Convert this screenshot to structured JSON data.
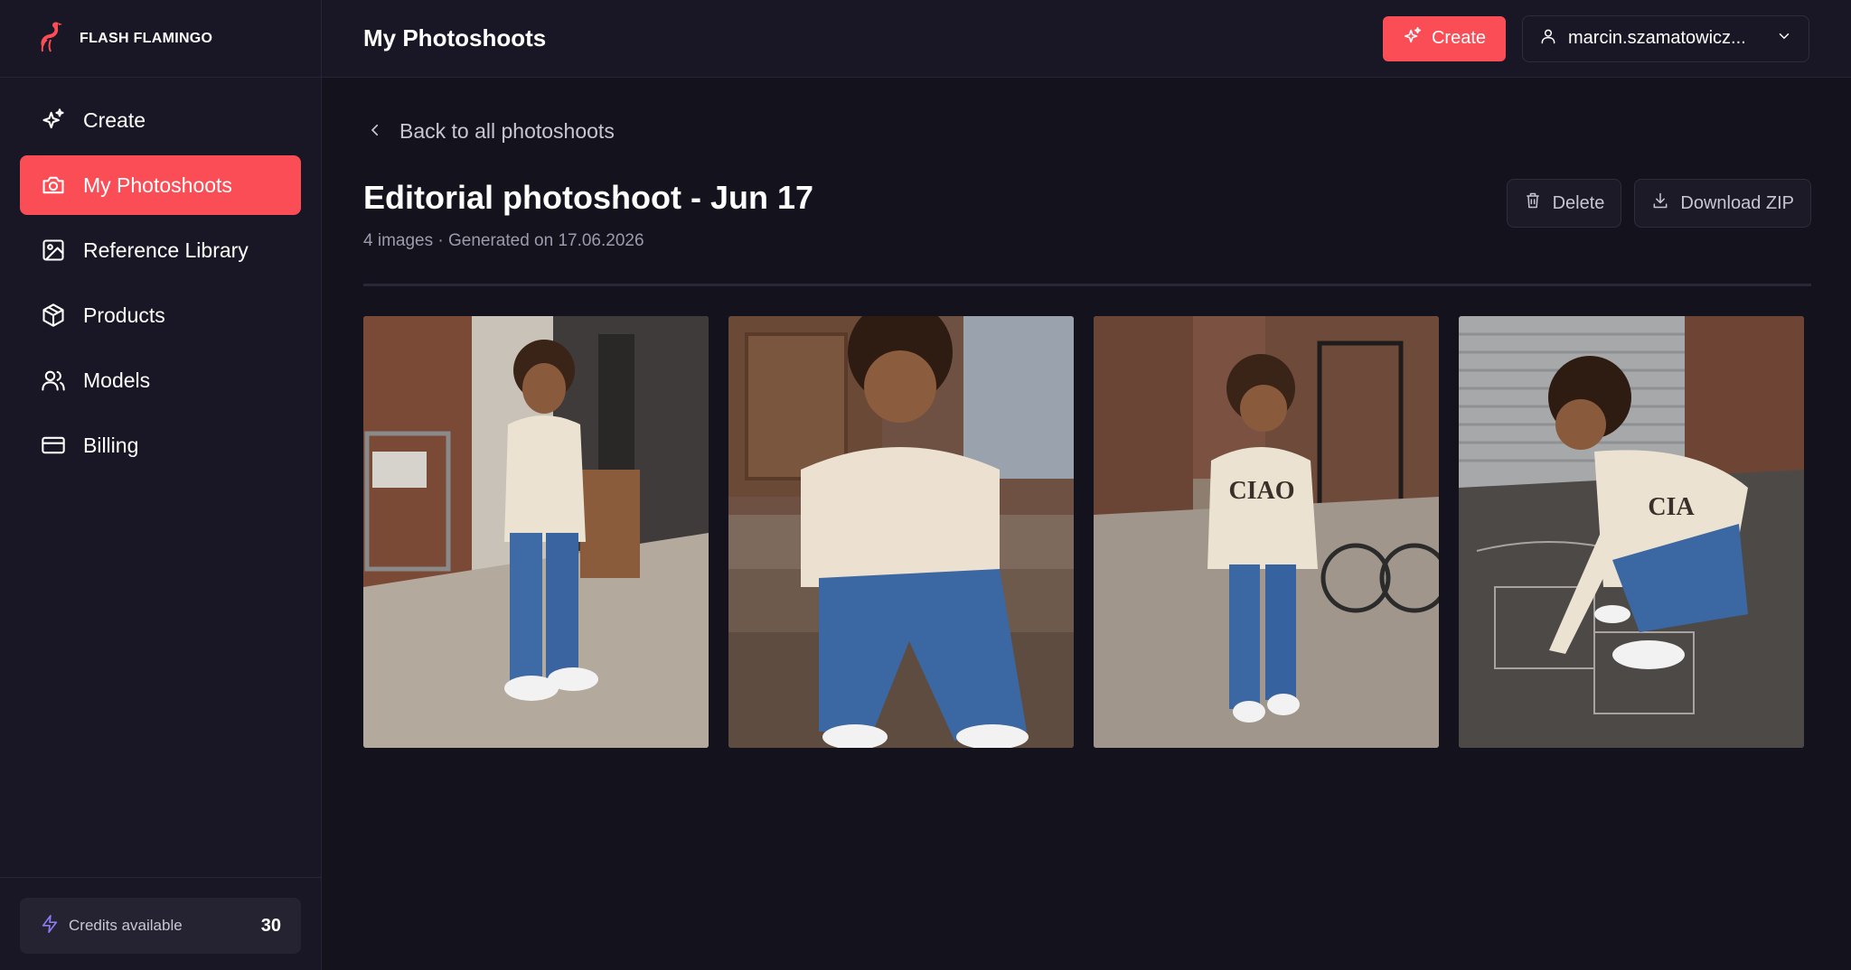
{
  "brand": {
    "name": "FLASH FLAMINGO"
  },
  "header": {
    "title": "My Photoshoots",
    "create_label": "Create",
    "user_name": "marcin.szamatowicz..."
  },
  "sidebar": {
    "items": [
      {
        "label": "Create",
        "icon": "sparkle-icon"
      },
      {
        "label": "My Photoshoots",
        "icon": "camera-icon",
        "active": true
      },
      {
        "label": "Reference Library",
        "icon": "image-icon"
      },
      {
        "label": "Products",
        "icon": "box-icon"
      },
      {
        "label": "Models",
        "icon": "users-icon"
      },
      {
        "label": "Billing",
        "icon": "credit-card-icon"
      }
    ],
    "credits_label": "Credits available",
    "credits_value": "30"
  },
  "main": {
    "back_label": "Back to all photoshoots",
    "title": "Editorial photoshoot - Jun 17",
    "subtitle": "4 images · Generated on 17.06.2026",
    "delete_label": "Delete",
    "download_label": "Download ZIP",
    "photos": [
      {
        "name": "photo-1"
      },
      {
        "name": "photo-2"
      },
      {
        "name": "photo-3",
        "sweater_text": "CIAO"
      },
      {
        "name": "photo-4",
        "sweater_text": "CIA"
      }
    ]
  },
  "colors": {
    "accent": "#fa4d55",
    "background": "#14121d",
    "sidebar": "#191725"
  }
}
